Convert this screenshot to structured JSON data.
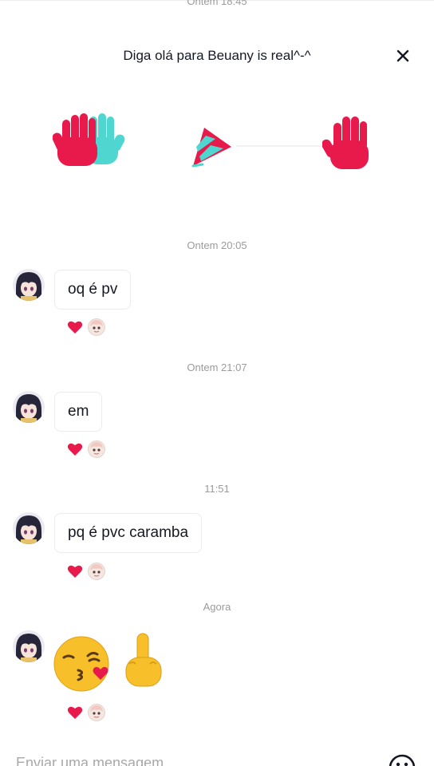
{
  "timestamps": {
    "top": "Ontem 18:45",
    "t1": "Ontem 20:05",
    "t2": "Ontem 21:07",
    "t3": "11:51",
    "t4": "Agora"
  },
  "greeting": {
    "title": "Diga olá para Beuany is real^-^",
    "close_icon": "close-icon",
    "stickers": [
      "high-five-hands-sticker",
      "party-hat-sticker",
      "waving-hand-sticker"
    ]
  },
  "messages": [
    {
      "text": "oq é pv"
    },
    {
      "text": "em"
    },
    {
      "text": "pq é pvc caramba"
    },
    {
      "emojis": [
        "kissing-face-emoji",
        "middle-finger-emoji"
      ]
    }
  ],
  "reaction": {
    "icon": "heart-icon",
    "color": "#e8194b"
  },
  "composer": {
    "placeholder": "Enviar uma mensagem",
    "emoji_button": "smiley-icon"
  },
  "colors": {
    "accent": "#e8194b",
    "teal": "#4fd6d0",
    "text": "#161823",
    "muted": "#9b9b9b"
  }
}
